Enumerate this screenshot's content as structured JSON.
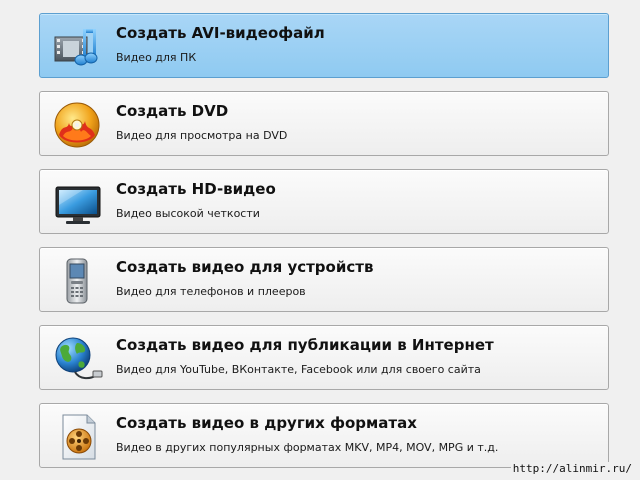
{
  "options": [
    {
      "title": "Создать AVI-видеофайл",
      "subtitle": "Видео для ПК",
      "icon": "film-music-icon",
      "selected": true
    },
    {
      "title": "Создать DVD",
      "subtitle": "Видео для просмотра на DVD",
      "icon": "dvd-disc-icon",
      "selected": false
    },
    {
      "title": "Создать HD-видео",
      "subtitle": "Видео высокой четкости",
      "icon": "monitor-icon",
      "selected": false
    },
    {
      "title": "Создать видео для устройств",
      "subtitle": "Видео для телефонов и плееров",
      "icon": "mobile-phone-icon",
      "selected": false
    },
    {
      "title": "Создать видео для публикации в Интернет",
      "subtitle": "Видео для YouTube, ВКонтакте, Facebook или для своего сайта",
      "icon": "globe-icon",
      "selected": false
    },
    {
      "title": "Создать видео в других форматах",
      "subtitle": "Видео в других популярных форматах MKV, MP4, MOV, MPG и т.д.",
      "icon": "film-reel-file-icon",
      "selected": false
    }
  ],
  "watermark": "http://alinmir.ru/",
  "colors": {
    "selected_background": "#9fd1f4",
    "selected_border": "#5c9fd0",
    "button_border": "#a8a8a8",
    "page_background": "#f0f0f0"
  }
}
